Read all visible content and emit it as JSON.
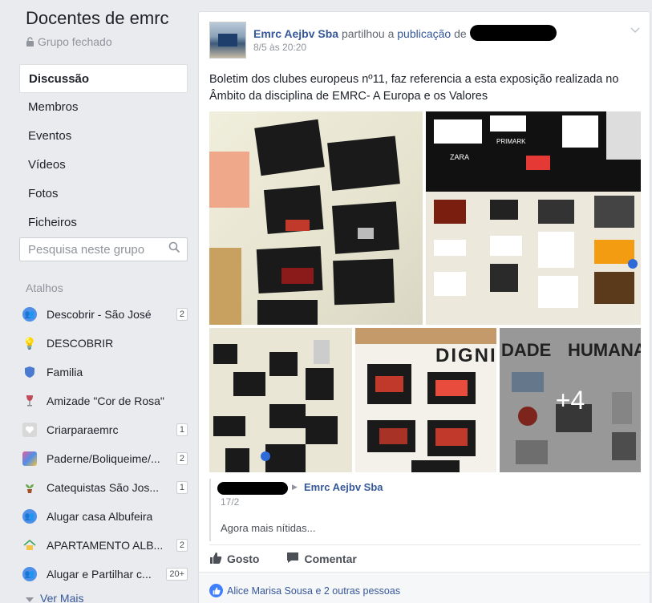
{
  "group": {
    "title": "Docentes de emrc",
    "privacy": "Grupo fechado",
    "lock_icon": "lock-icon"
  },
  "nav": {
    "items": [
      {
        "label": "Discussão",
        "active": true
      },
      {
        "label": "Membros"
      },
      {
        "label": "Eventos"
      },
      {
        "label": "Vídeos"
      },
      {
        "label": "Fotos"
      },
      {
        "label": "Ficheiros"
      }
    ]
  },
  "search": {
    "placeholder": "Pesquisa neste grupo",
    "icon": "search-icon"
  },
  "shortcuts": {
    "title": "Atalhos",
    "items": [
      {
        "label": "Descobrir - São José",
        "badge": "2",
        "icon": "group-icon",
        "color": "#4f8fe8"
      },
      {
        "label": "DESCOBRIR",
        "badge": "",
        "icon": "lightbulb-icon",
        "color": "#f6c342"
      },
      {
        "label": "Familia",
        "badge": "",
        "icon": "shield-icon",
        "color": "#4a7bd0"
      },
      {
        "label": "Amizade \"Cor de Rosa\"",
        "badge": "",
        "icon": "wine-icon",
        "color": "#c24b5a"
      },
      {
        "label": "Criarparaemrc",
        "badge": "1",
        "icon": "heart-icon",
        "color": "#c9c9c9"
      },
      {
        "label": "Paderne/Boliqueime/...",
        "badge": "2",
        "icon": "photo-icon",
        "color": "#e05e9a"
      },
      {
        "label": "Catequistas São Jos...",
        "badge": "1",
        "icon": "plant-icon",
        "color": "#6aa84f"
      },
      {
        "label": "Alugar casa Albufeira",
        "badge": "",
        "icon": "group-icon",
        "color": "#4f8fe8"
      },
      {
        "label": "APARTAMENTO ALB...",
        "badge": "2",
        "icon": "house-icon",
        "color": "#3ba55c"
      },
      {
        "label": "Alugar e Partilhar c...",
        "badge": "20+",
        "icon": "group-icon",
        "color": "#4f8fe8"
      }
    ],
    "see_more": "Ver Mais"
  },
  "post": {
    "author": "Emrc Aejbv Sba",
    "shared_text": "partilhou a",
    "publication_link": "publicação",
    "of_text": "de",
    "time": "8/5 às 20:20",
    "text": "Boletim dos clubes europeus nº11, faz referencia a esta exposição realizada no Âmbito da disciplina de EMRC- A Europa e os Valores",
    "photos_more": "+4",
    "photo_labels": {
      "p2_brand1": "PRIMARK",
      "p2_brand2": "ZARA",
      "p4_word": "DIGNI",
      "p5_word1": "DADE",
      "p5_word2": "HUMANA"
    },
    "shared_from": {
      "author": "Emrc Aejbv Sba",
      "date": "17/2",
      "text": "Agora mais nítidas..."
    },
    "actions": {
      "like": "Gosto",
      "comment": "Comentar"
    },
    "likes_text": "Alice Marisa Sousa e 2 outras pessoas"
  }
}
